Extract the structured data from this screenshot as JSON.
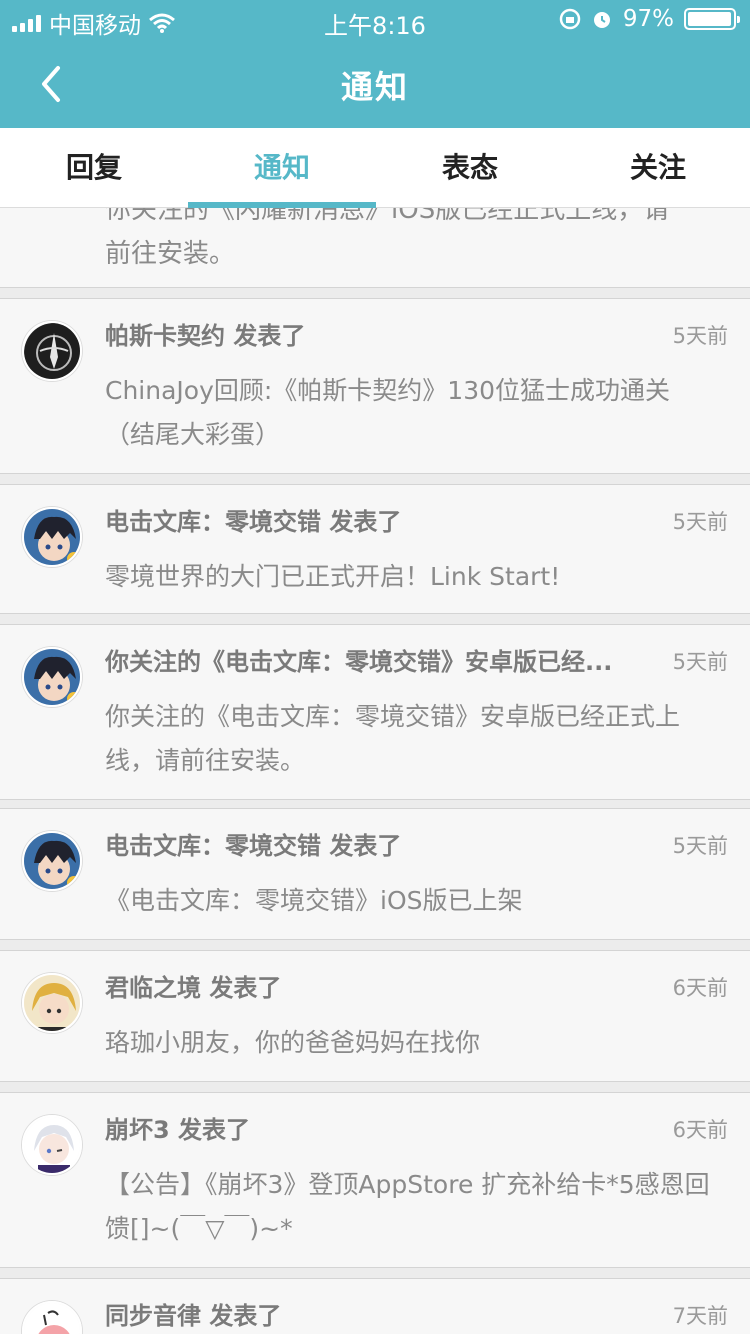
{
  "status_bar": {
    "carrier": "中国移动",
    "time": "上午8:16",
    "battery": "97%",
    "battery_level": 0.97
  },
  "nav": {
    "title": "通知",
    "back_icon": "chevron-left-icon"
  },
  "tabs": [
    {
      "label": "回复",
      "active": false
    },
    {
      "label": "通知",
      "active": true
    },
    {
      "label": "表态",
      "active": false
    },
    {
      "label": "关注",
      "active": false
    }
  ],
  "partial_item": {
    "body_line1": "你关注的《闪耀新消息》iOS版已经正式上线，请",
    "body_line2": "前往安装。"
  },
  "notifications": [
    {
      "title": "帕斯卡契约 发表了",
      "time": "5天前",
      "body": "ChinaJoy回顾:《帕斯卡契约》130位猛士成功通关 （结尾大彩蛋）",
      "avatar": "pascal-avatar"
    },
    {
      "title": "电击文库：零境交错 发表了",
      "time": "5天前",
      "body": "零境世界的大门已正式开启！Link Start!",
      "avatar": "anime-boy-avatar"
    },
    {
      "title": "你关注的《电击文库：零境交错》安卓版已经...",
      "time": "5天前",
      "body": "你关注的《电击文库：零境交错》安卓版已经正式上线，请前往安装。",
      "avatar": "anime-boy-avatar"
    },
    {
      "title": "电击文库：零境交错 发表了",
      "time": "5天前",
      "body": "《电击文库：零境交错》iOS版已上架",
      "avatar": "anime-boy-avatar"
    },
    {
      "title": "君临之境 发表了",
      "time": "6天前",
      "body": "珞珈小朋友，你的爸爸妈妈在找你",
      "avatar": "blonde-girl-avatar"
    },
    {
      "title": "崩坏3 发表了",
      "time": "6天前",
      "body": "【公告】《崩坏3》登顶AppStore 扩充补给卡*5感恩回馈[]~(￣▽￣)~*",
      "avatar": "white-hair-girl-avatar"
    },
    {
      "title": "同步音律 发表了",
      "time": "7天前",
      "body": "",
      "avatar": "pink-character-avatar"
    }
  ],
  "colors": {
    "accent": "#56b8c8",
    "card_bg": "#f7f7f7",
    "text_secondary": "#8a8a8a"
  }
}
